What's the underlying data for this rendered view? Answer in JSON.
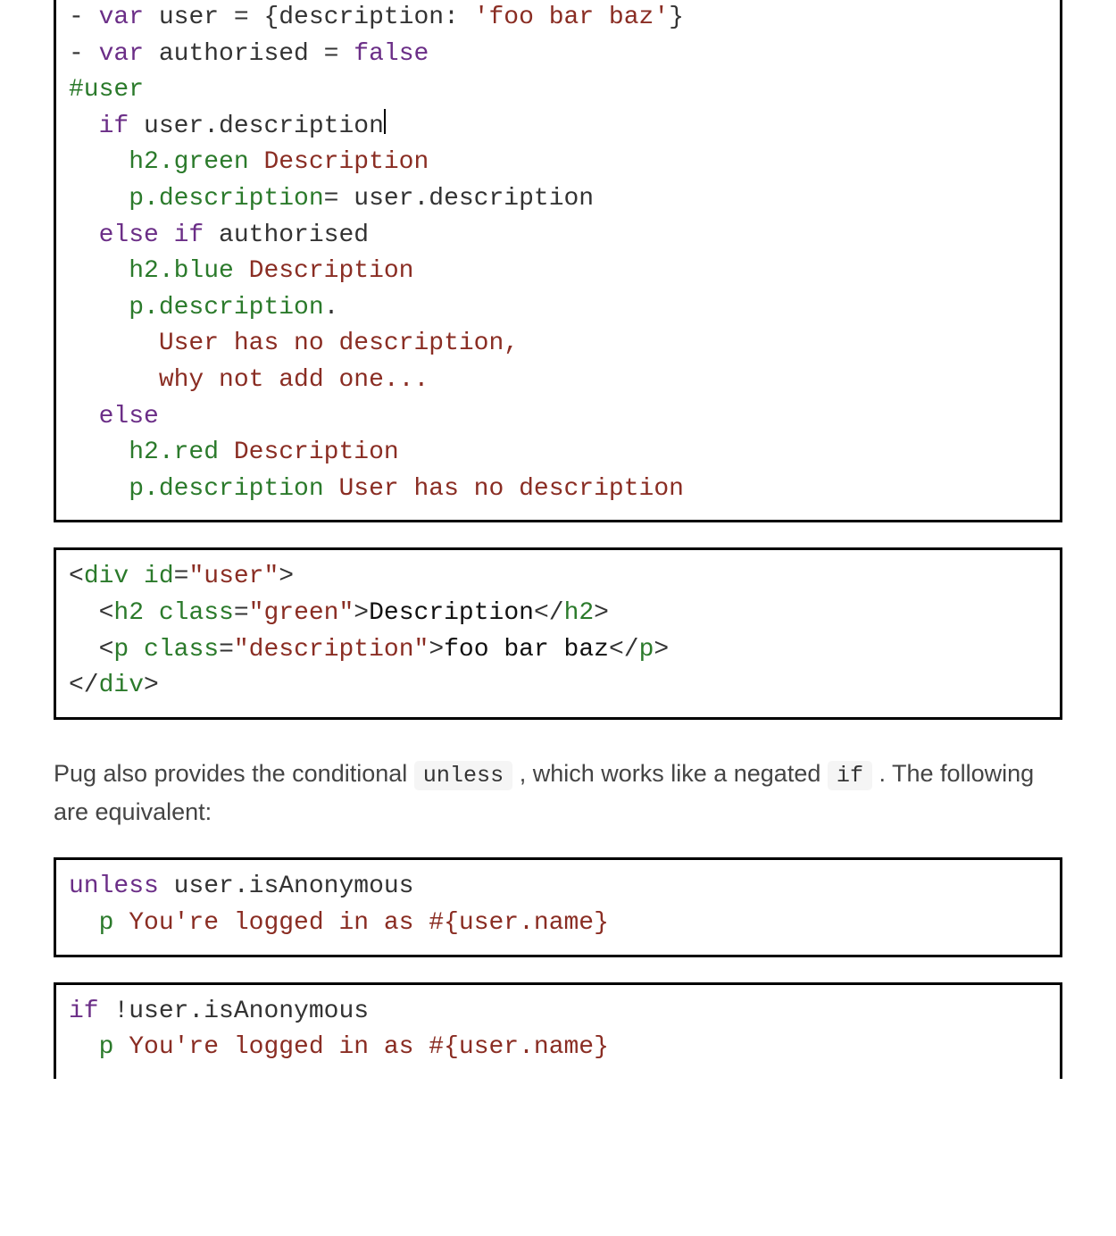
{
  "code1": {
    "l1": {
      "a": "- ",
      "b": "var",
      "c": " user = {description: ",
      "d": "'foo bar baz'",
      "e": "}"
    },
    "l2": {
      "a": "- ",
      "b": "var",
      "c": " authorised = ",
      "d": "false"
    },
    "l3": {
      "a": "#user"
    },
    "l4": {
      "a": "  ",
      "b": "if",
      "c": " user.description"
    },
    "l5": {
      "a": "    ",
      "b": "h2.green",
      "c": " Description"
    },
    "l6": {
      "a": "    ",
      "b": "p.description",
      "c": "= user.description"
    },
    "l7": {
      "a": "  ",
      "b": "else if",
      "c": " authorised"
    },
    "l8": {
      "a": "    ",
      "b": "h2.blue",
      "c": " Description"
    },
    "l9": {
      "a": "    ",
      "b": "p.description",
      "c": "."
    },
    "l10": {
      "a": "      ",
      "b": "User has no description,"
    },
    "l11": {
      "a": "      ",
      "b": "why not add one..."
    },
    "l12": {
      "a": "  ",
      "b": "else"
    },
    "l13": {
      "a": "    ",
      "b": "h2.red",
      "c": " Description"
    },
    "l14": {
      "a": "    ",
      "b": "p.description",
      "c": " User has no description"
    }
  },
  "code2": {
    "l1": {
      "a": "<",
      "b": "div",
      "c": " ",
      "d": "id",
      "e": "=",
      "f": "\"user\"",
      "g": ">"
    },
    "l2": {
      "a": "  <",
      "b": "h2",
      "c": " ",
      "d": "class",
      "e": "=",
      "f": "\"green\"",
      "g": ">",
      "h": "Description",
      "i": "</",
      "j": "h2",
      "k": ">"
    },
    "l3": {
      "a": "  <",
      "b": "p",
      "c": " ",
      "d": "class",
      "e": "=",
      "f": "\"description\"",
      "g": ">",
      "h": "foo bar baz",
      "i": "</",
      "j": "p",
      "k": ">"
    },
    "l4": {
      "a": "</",
      "b": "div",
      "c": ">"
    }
  },
  "prose": {
    "t1": "Pug also provides the conditional ",
    "ic1": "unless",
    "t2": " , which works like a negated ",
    "ic2": "if",
    "t3": " . The following are equivalent:"
  },
  "code3": {
    "l1": {
      "a": "unless",
      "b": " user.isAnonymous"
    },
    "l2": {
      "a": "  ",
      "b": "p",
      "c": " You're logged in as #{user.name}"
    }
  },
  "code4": {
    "l1": {
      "a": "if",
      "b": " !user.isAnonymous"
    },
    "l2": {
      "a": "  ",
      "b": "p",
      "c": " You're logged in as #{user.name}"
    }
  }
}
